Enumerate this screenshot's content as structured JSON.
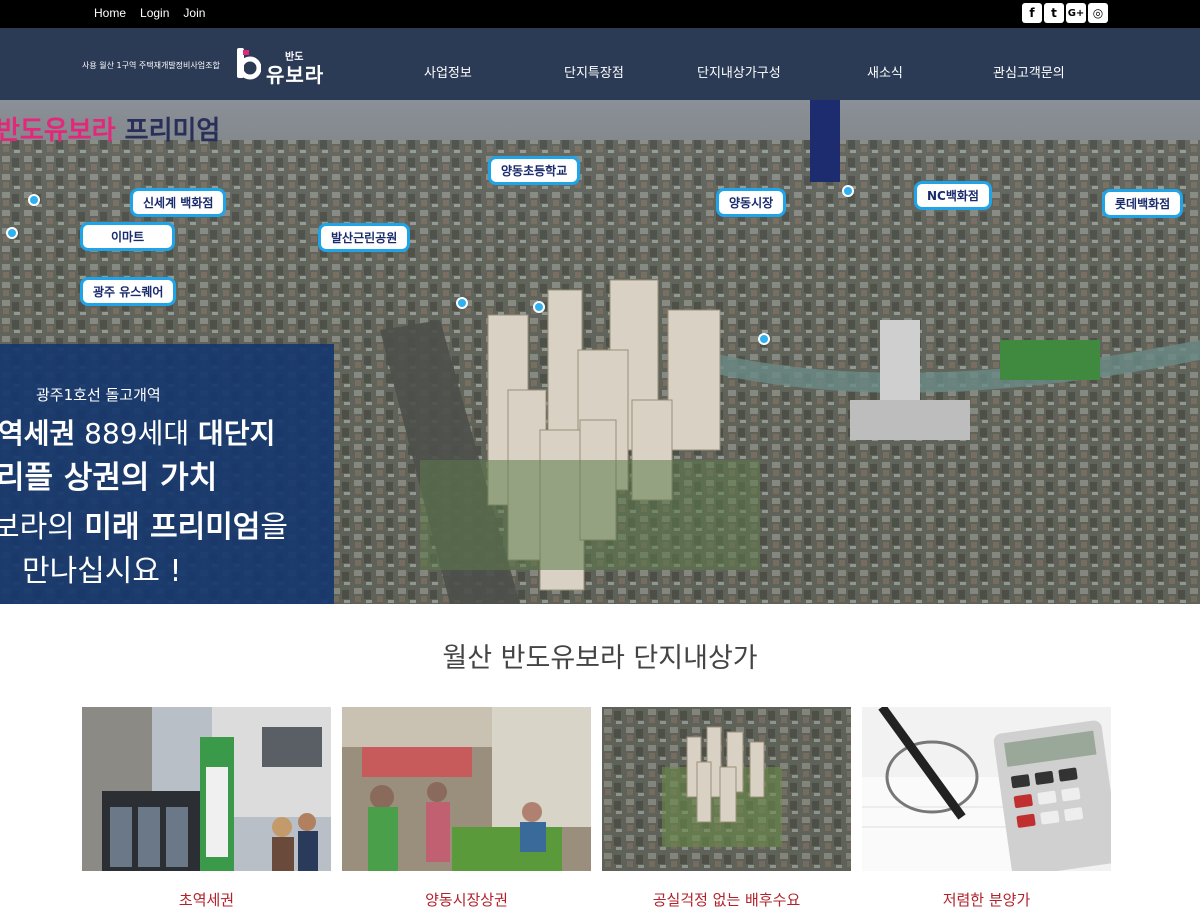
{
  "topbar": {
    "links": [
      "Home",
      "Login",
      "Join"
    ],
    "social": [
      {
        "icon": "facebook-icon",
        "glyph": "f"
      },
      {
        "icon": "twitter-icon",
        "glyph": "t"
      },
      {
        "icon": "googleplus-icon",
        "glyph": "G+"
      },
      {
        "icon": "instagram-icon",
        "glyph": "◎"
      }
    ]
  },
  "header": {
    "tagline": "사용 월산 1구역 주택재개발정비사업조합",
    "logo_small": "반도",
    "logo_main": "유보라",
    "nav": [
      "사업정보",
      "단지특장점",
      "단지내상가구성",
      "새소식",
      "관심고객문의"
    ]
  },
  "hero": {
    "title_part1": "반도유보라",
    "title_part2": "프리미엄",
    "pins": [
      "신세계 백화점",
      "이마트",
      "광주 유스퀘어",
      "발산근린공원",
      "양동초등학교",
      "양동시장",
      "NC백화점",
      "롯데백화점"
    ],
    "promo": {
      "line1": "광주1호선 돌고개역",
      "line2_a": "역세권",
      "line2_b": " 889세대 ",
      "line2_c": "대단지",
      "line3": "리플 상권의 가치",
      "line4_a": "보라의 ",
      "line4_b": "미래 프리미엄",
      "line4_c": "을",
      "line5": "만나십시요 !"
    }
  },
  "section": {
    "title": "월산 반도유보라 단지내상가",
    "cards": [
      {
        "caption": "초역세권"
      },
      {
        "caption": "양동시장상권"
      },
      {
        "caption": "공실걱정 없는 배후수요"
      },
      {
        "caption": "저렴한 분양가"
      }
    ]
  },
  "colors": {
    "topbar": "#000000",
    "header": "#2b3a55",
    "accent_pink": "#e4277b",
    "pin_border": "#1fa4e8",
    "promo_bg": "#16376e",
    "caption": "#b3222a"
  }
}
